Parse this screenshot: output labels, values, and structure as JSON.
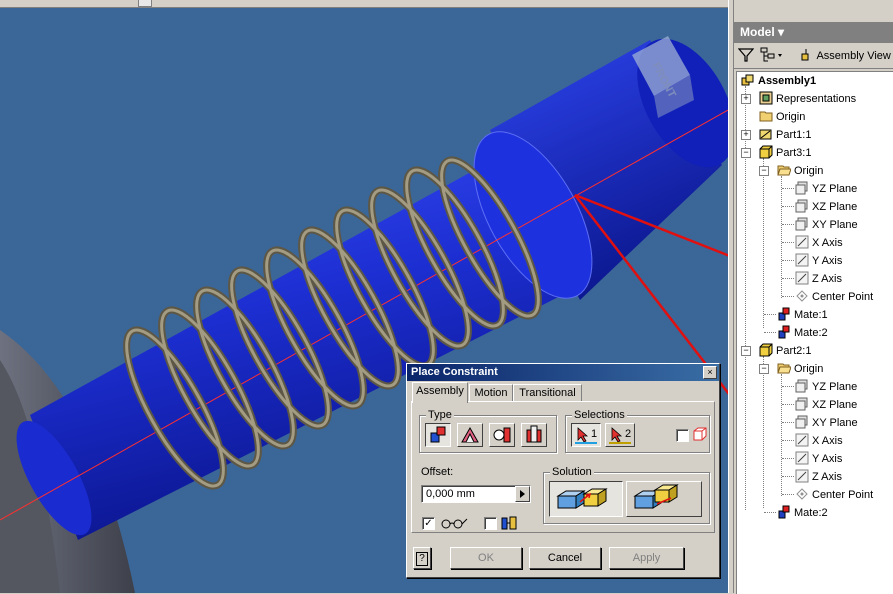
{
  "viewcube": {
    "label": "FRONT"
  },
  "browser": {
    "title": "Model",
    "title_arrow": "▾",
    "view_label": "Assembly View",
    "tree": [
      {
        "label": "Assembly1",
        "bold": true
      },
      {
        "label": "Representations"
      },
      {
        "label": "Origin"
      },
      {
        "label": "Part1:1"
      },
      {
        "label": "Part3:1"
      },
      {
        "label": "Origin"
      },
      {
        "label": "YZ Plane"
      },
      {
        "label": "XZ Plane"
      },
      {
        "label": "XY Plane"
      },
      {
        "label": "X Axis"
      },
      {
        "label": "Y Axis"
      },
      {
        "label": "Z Axis"
      },
      {
        "label": "Center Point"
      },
      {
        "label": "Mate:1"
      },
      {
        "label": "Mate:2"
      },
      {
        "label": "Part2:1"
      },
      {
        "label": "Origin"
      },
      {
        "label": "YZ Plane"
      },
      {
        "label": "XZ Plane"
      },
      {
        "label": "XY Plane"
      },
      {
        "label": "X Axis"
      },
      {
        "label": "Y Axis"
      },
      {
        "label": "Z Axis"
      },
      {
        "label": "Center Point"
      },
      {
        "label": "Mate:2"
      }
    ]
  },
  "dialog": {
    "title": "Place Constraint",
    "close": "×",
    "tabs": [
      "Assembly",
      "Motion",
      "Transitional"
    ],
    "type_label": "Type",
    "selections_label": "Selections",
    "selection_1": "1",
    "selection_2": "2",
    "offset_label": "Offset:",
    "offset_value": "0,000 mm",
    "solution_label": "Solution",
    "ok": "OK",
    "cancel": "Cancel",
    "apply": "Apply",
    "help": "?",
    "show_preview_checked": true,
    "predict_offset_checked": false
  },
  "colors": {
    "viewport_bg": "#3b6698",
    "shaft": "#1f2fd6",
    "spring": "#8e8670",
    "arrow": "#e01010",
    "axis_line": "#ff3030"
  }
}
